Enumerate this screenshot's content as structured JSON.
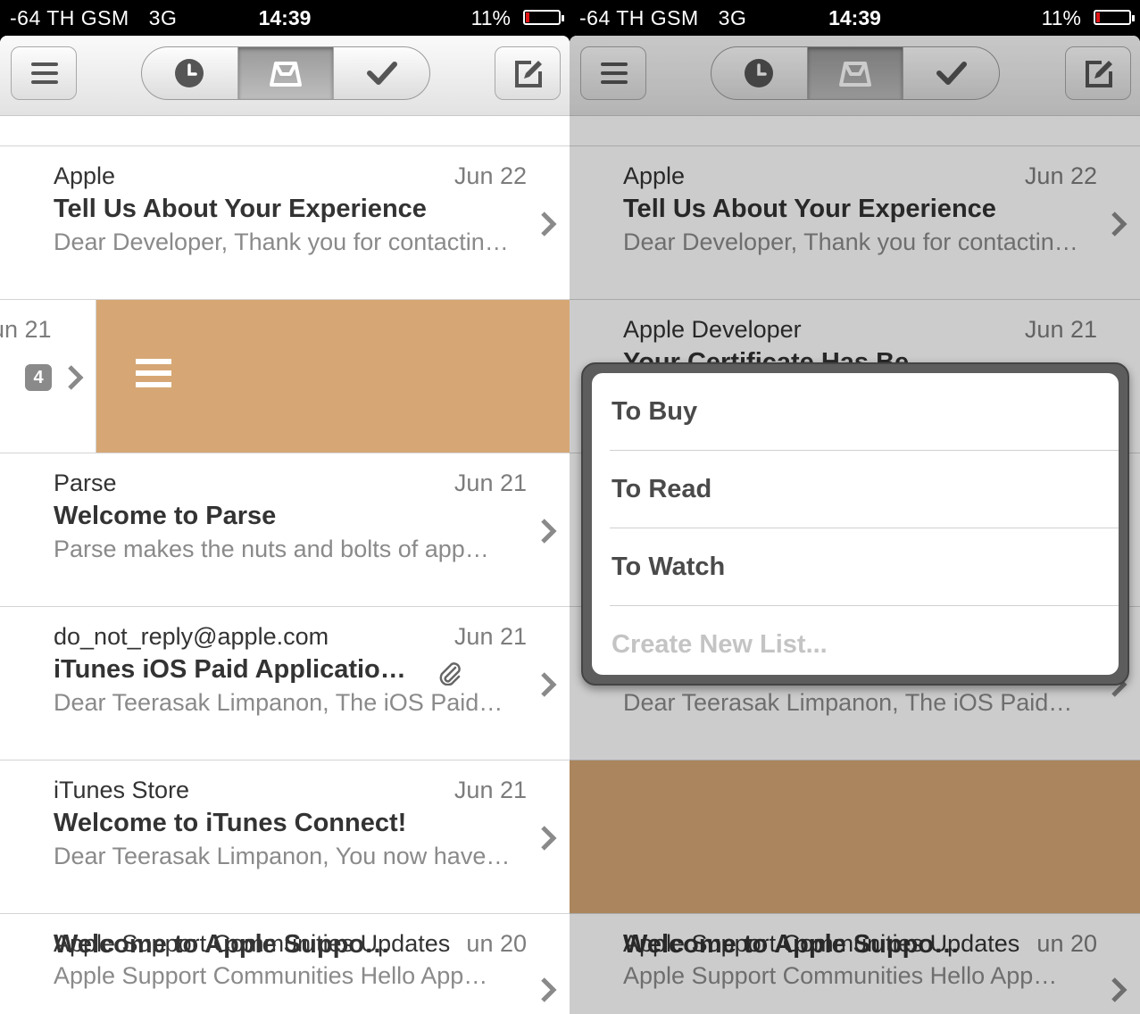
{
  "status": {
    "carrier": "-64 TH GSM",
    "network": "3G",
    "time": "14:39",
    "battery": "11%",
    "battery_level": 0.11
  },
  "colors": {
    "swipe_action": "#d6a775",
    "badge": "#8a8a8a"
  },
  "icons": {
    "menu": "hamburger-icon",
    "later": "clock-icon",
    "inbox": "inbox-icon",
    "done": "checkmark-icon",
    "compose": "compose-icon",
    "list": "list-icon",
    "chevron": "chevron-right-icon",
    "attachment": "paperclip-icon"
  },
  "emails": [
    {
      "sender": "Apple",
      "date": "Jun 22",
      "subject": "Tell Us About Your Experience",
      "preview": "Dear Developer, Thank you for contacting…"
    },
    {
      "sender": "Apple Developer",
      "date": "Jun 21",
      "subject": "Your Certificate Has Be…",
      "preview": "",
      "badge": "4"
    },
    {
      "sender": "Parse",
      "date": "Jun 21",
      "subject": "Welcome to Parse",
      "preview": "Parse makes the nuts and bolts of app…"
    },
    {
      "sender": "do_not_reply@apple.com",
      "date": "Jun 21",
      "subject": "iTunes iOS Paid Applicatio…",
      "preview": "Dear Teerasak Limpanon, The iOS Paid…"
    },
    {
      "sender": "iTunes Store",
      "date": "Jun 21",
      "subject": "Welcome to iTunes Connect!",
      "preview": "Dear Teerasak Limpanon, You now have…"
    },
    {
      "sender": "Apple Support Communities Updates",
      "date": "Jun 20",
      "subject": "Welcome to Apple Suppo…",
      "preview": "Apple Support Communities Hello App…"
    }
  ],
  "swiped_date_fragment": "un 21",
  "partial_date_fragment": "un 20",
  "lists": [
    {
      "label": "To Buy"
    },
    {
      "label": "To Read"
    },
    {
      "label": "To Watch"
    },
    {
      "label": "Create New List..."
    }
  ]
}
